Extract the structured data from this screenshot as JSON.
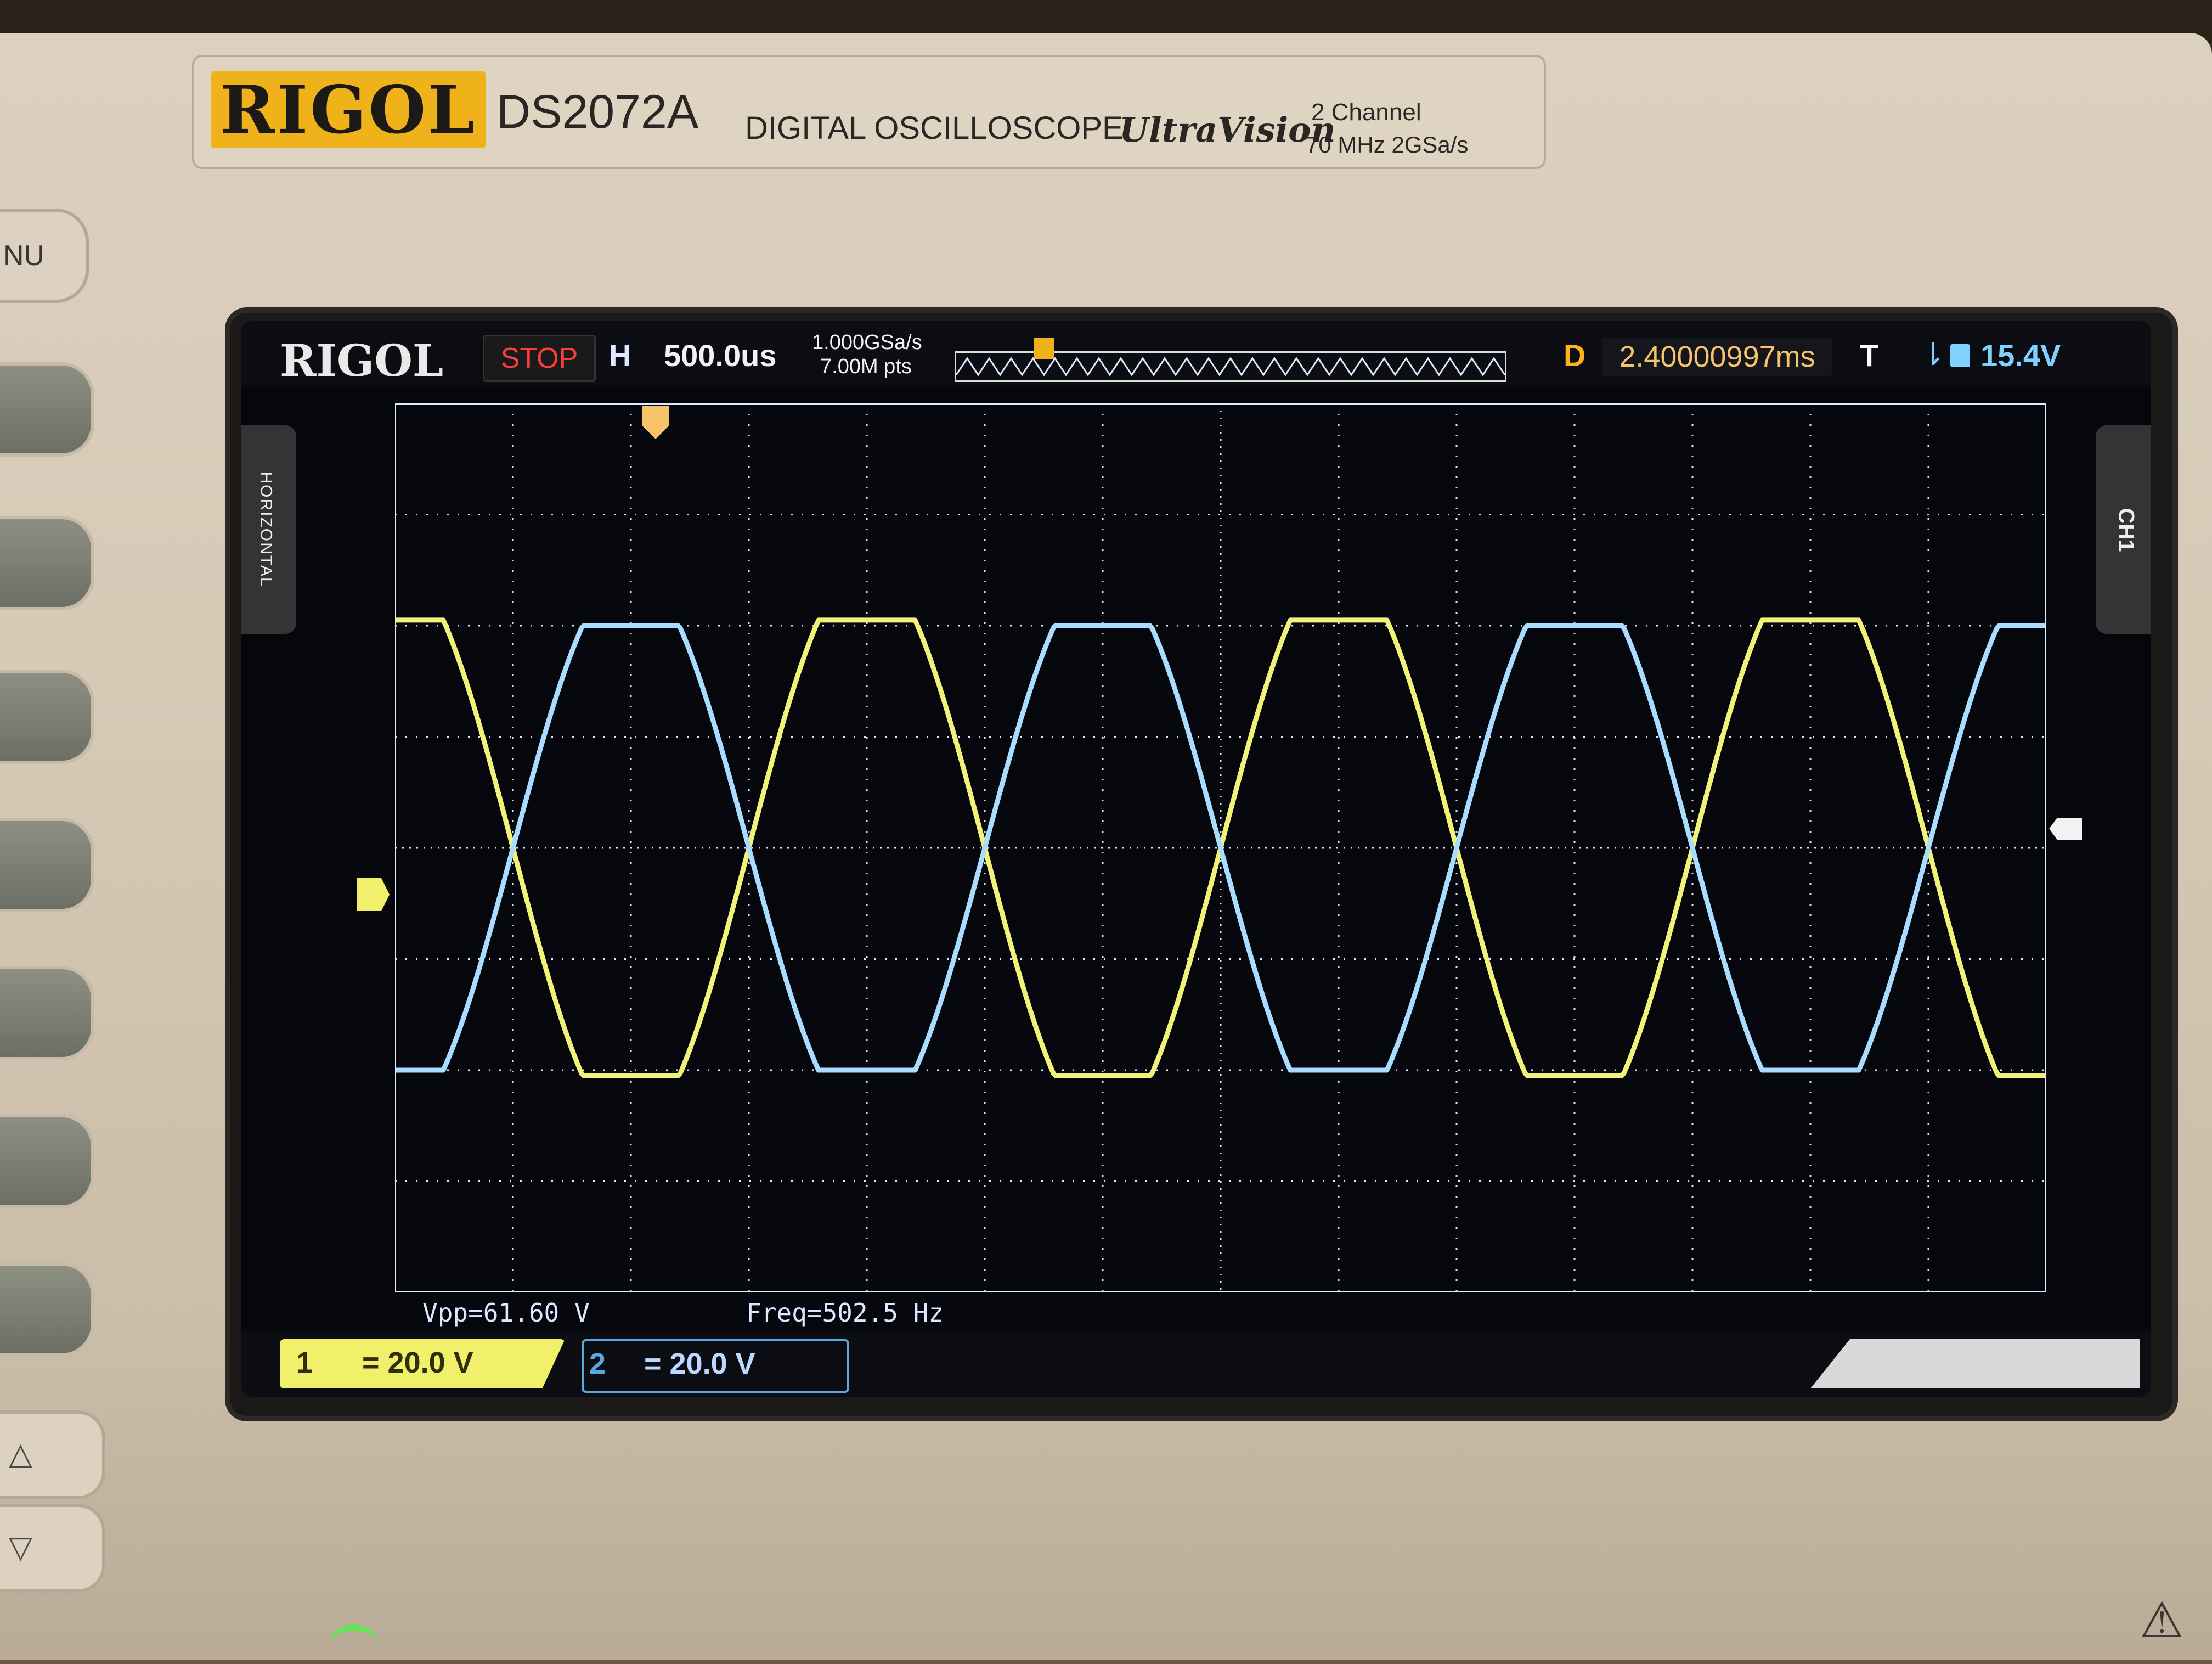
{
  "device": {
    "brand": "RIGOL",
    "model": "DS2072A",
    "description": "DIGITAL OSCILLOSCOPE",
    "series": "UltraVision",
    "spec_channels": "2 Channel",
    "spec_bandwidth": "70  MHz  2GSa/s",
    "menu_key": "NU"
  },
  "screen": {
    "logo": "RIGOL",
    "run_state": "STOP",
    "horizontal_badge": "H",
    "timebase": "500.0us",
    "sample_rate": "1.000GSa/s",
    "memory_depth": "7.00M pts",
    "delay_label": "D",
    "delay_value": "2.40000997ms",
    "trigger_label": "T",
    "trigger_level": "15.4V",
    "left_tab": "HORIZONTAL",
    "right_tab": "CH1",
    "measurements": {
      "vpp": "Vpp=61.60 V",
      "freq": "Freq=502.5 Hz"
    },
    "channels": [
      {
        "number": "1",
        "coupling_scale": "=  20.0 V",
        "color": "#f0f06a"
      },
      {
        "number": "2",
        "coupling_scale": "=  20.0 V",
        "color": "#8fd0ff"
      }
    ]
  },
  "colors": {
    "ch1_trace": "#f2f27a",
    "ch2_trace": "#a9dcff",
    "grid": "#dfe8ff",
    "accent": "#f0b21a"
  },
  "chart_data": {
    "type": "line",
    "grid_divisions": {
      "x": 14,
      "y": 8
    },
    "series": [
      {
        "name": "1",
        "shape": "clipped sine",
        "x": [
          0,
          0.5,
          1.0,
          1.5,
          2.0,
          2.5,
          3.0,
          3.5,
          4.0,
          4.5,
          5.0,
          5.5,
          6.0,
          6.5,
          7.0
        ],
        "y": [
          3.1,
          0.0,
          -3.1,
          0.0,
          3.1,
          0.0,
          -3.1,
          0.0,
          3.1,
          0.0,
          -3.1,
          0.0,
          3.1,
          0.0,
          -3.1
        ]
      },
      {
        "name": "2",
        "shape": "clipped sine",
        "x": [
          0,
          0.5,
          1.0,
          1.5,
          2.0,
          2.5,
          3.0,
          3.5,
          4.0,
          4.5,
          5.0,
          5.5,
          6.0,
          6.5,
          7.0
        ],
        "y": [
          -3.0,
          0.0,
          3.0,
          0.0,
          -3.0,
          0.0,
          3.0,
          0.0,
          -3.0,
          0.0,
          3.0,
          0.0,
          -3.0,
          0.0,
          3.0
        ]
      }
    ]
  }
}
